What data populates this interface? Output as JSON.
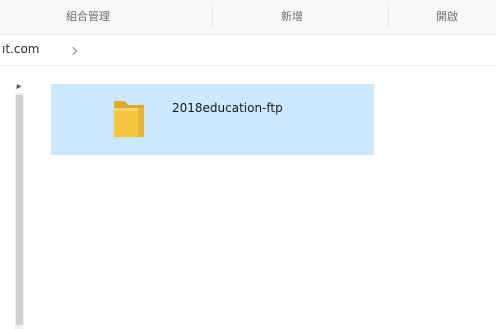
{
  "ribbon": {
    "groups": [
      {
        "label": "組合管理"
      },
      {
        "label": "新增"
      },
      {
        "label": "開啟"
      }
    ]
  },
  "address_bar": {
    "path_segment": "ıt.com"
  },
  "content": {
    "items": [
      {
        "name": "2018education-ftp",
        "type": "folder",
        "selected": true
      }
    ]
  },
  "colors": {
    "selection": "#cce8ff",
    "folder": "#f5c542",
    "ribbon_bg": "#f7f7f7"
  },
  "icons": [
    "folder-icon",
    "chevron-right-icon",
    "scroll-up-icon"
  ]
}
